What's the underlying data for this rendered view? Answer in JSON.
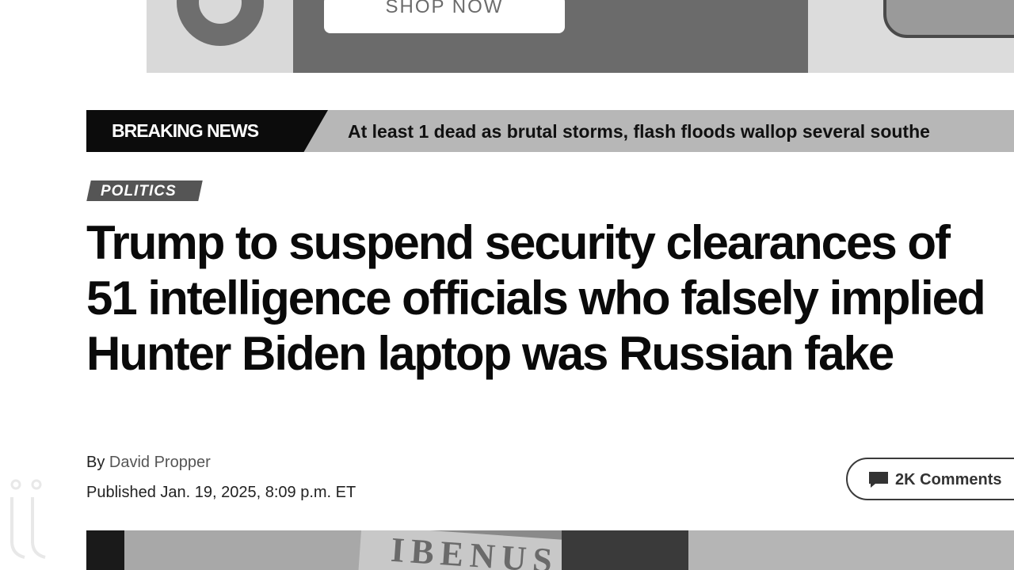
{
  "ad": {
    "button_label": "SHOP NOW"
  },
  "breaking": {
    "label": "BREAKING NEWS",
    "headline": "At least 1 dead as brutal storms, flash floods wallop several southe"
  },
  "article": {
    "category": "POLITICS",
    "headline": "Trump to suspend security clearances of 51 intelligence officials who falsely implied Hunter Biden laptop was Russian fake",
    "byline_prefix": "By",
    "author": "David Propper",
    "published": "Published Jan. 19, 2025, 8:09 p.m. ET",
    "comments_label": "2K Comments"
  },
  "image": {
    "sign_text": "IBENUS"
  },
  "icons": {
    "comments": "speech-bubble-icon",
    "ad_logo": "ring-logo-icon",
    "watermark": "watermark-icon"
  }
}
